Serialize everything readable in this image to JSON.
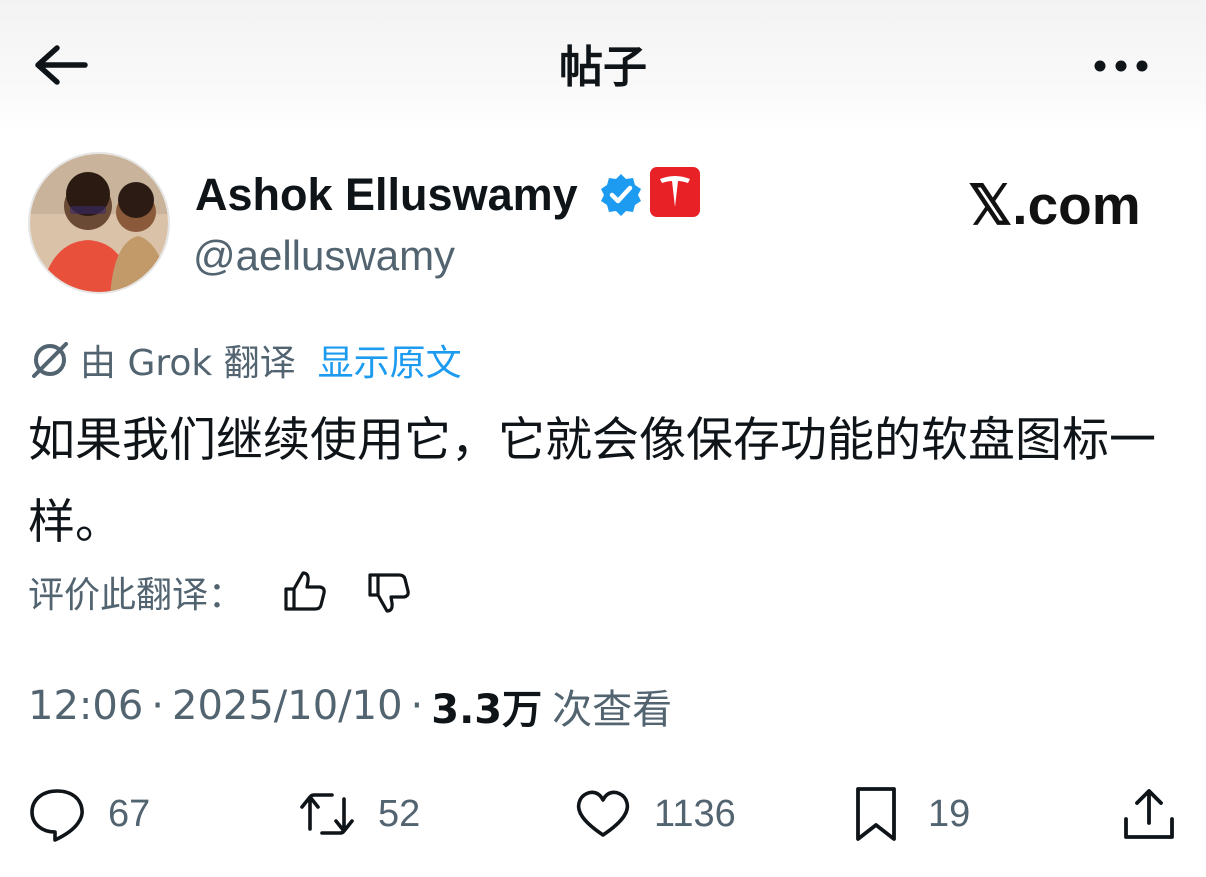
{
  "header": {
    "title": "帖子"
  },
  "author": {
    "display_name": "Ashok Elluswamy",
    "handle": "@aelluswamy",
    "affiliate_color": "#e82127"
  },
  "watermark": "𝕏.com",
  "translation": {
    "by_label": "由 Grok 翻译",
    "show_original": "显示原文"
  },
  "tweet": {
    "text": "如果我们继续使用它，它就会像保存功能的软盘图标一样。"
  },
  "rate": {
    "label": "评价此翻译："
  },
  "meta": {
    "time": "12:06",
    "date": "2025/10/10",
    "views_count": "3.3万",
    "views_label": "次查看"
  },
  "actions": {
    "replies": "67",
    "reposts": "52",
    "likes": "1136",
    "bookmarks": "19"
  },
  "colors": {
    "accent": "#1d9bf0",
    "secondary_text": "#536471"
  }
}
